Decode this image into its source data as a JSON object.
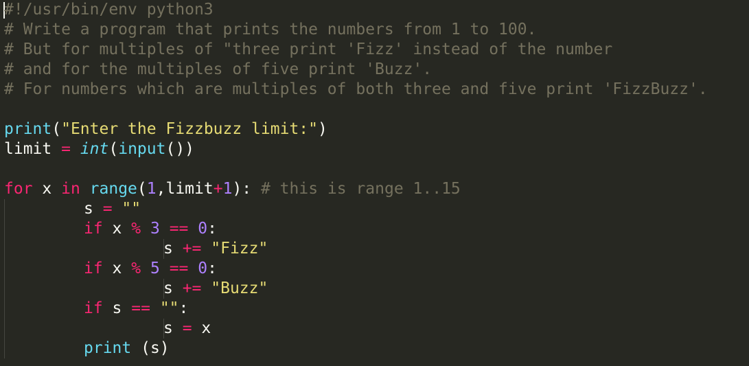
{
  "editor": {
    "theme": {
      "background": "#272822",
      "foreground": "#f8f8f2",
      "comment": "#75715e",
      "keyword": "#f92672",
      "builtin": "#66d9ef",
      "string": "#e6db74",
      "number": "#ae81ff"
    },
    "lines": [
      {
        "indent": 0,
        "tokens": [
          [
            "comment",
            "#!/usr/bin/env python3"
          ]
        ]
      },
      {
        "indent": 0,
        "tokens": [
          [
            "comment",
            "# Write a program that prints the numbers from 1 to 100."
          ]
        ]
      },
      {
        "indent": 0,
        "tokens": [
          [
            "comment",
            "# But for multiples of \"three print 'Fizz' instead of the number"
          ]
        ]
      },
      {
        "indent": 0,
        "tokens": [
          [
            "comment",
            "# and for the multiples of five print 'Buzz'."
          ]
        ]
      },
      {
        "indent": 0,
        "tokens": [
          [
            "comment",
            "# For numbers which are multiples of both three and five print 'FizzBuzz'."
          ]
        ]
      },
      {
        "indent": 0,
        "tokens": []
      },
      {
        "indent": 0,
        "tokens": [
          [
            "builtin",
            "print"
          ],
          [
            "text",
            "("
          ],
          [
            "string",
            "\"Enter the Fizzbuzz limit:\""
          ],
          [
            "text",
            ")"
          ]
        ]
      },
      {
        "indent": 0,
        "tokens": [
          [
            "text",
            "limit "
          ],
          [
            "operator",
            "="
          ],
          [
            "text",
            " "
          ],
          [
            "type",
            "int"
          ],
          [
            "text",
            "("
          ],
          [
            "builtin",
            "input"
          ],
          [
            "text",
            "())"
          ]
        ]
      },
      {
        "indent": 0,
        "tokens": []
      },
      {
        "indent": 0,
        "tokens": [
          [
            "keyword",
            "for"
          ],
          [
            "text",
            " x "
          ],
          [
            "keyword",
            "in"
          ],
          [
            "text",
            " "
          ],
          [
            "builtin",
            "range"
          ],
          [
            "text",
            "("
          ],
          [
            "number",
            "1"
          ],
          [
            "text",
            ",limit"
          ],
          [
            "operator",
            "+"
          ],
          [
            "number",
            "1"
          ],
          [
            "text",
            "): "
          ],
          [
            "comment",
            "# this is range 1..15"
          ]
        ]
      },
      {
        "indent": 1,
        "tokens": [
          [
            "text",
            "s "
          ],
          [
            "operator",
            "="
          ],
          [
            "text",
            " "
          ],
          [
            "string",
            "\"\""
          ]
        ]
      },
      {
        "indent": 1,
        "tokens": [
          [
            "keyword",
            "if"
          ],
          [
            "text",
            " x "
          ],
          [
            "operator",
            "%"
          ],
          [
            "text",
            " "
          ],
          [
            "number",
            "3"
          ],
          [
            "text",
            " "
          ],
          [
            "operator",
            "=="
          ],
          [
            "text",
            " "
          ],
          [
            "number",
            "0"
          ],
          [
            "text",
            ":"
          ]
        ]
      },
      {
        "indent": 2,
        "tokens": [
          [
            "text",
            "s "
          ],
          [
            "operator",
            "+="
          ],
          [
            "text",
            " "
          ],
          [
            "string",
            "\"Fizz\""
          ]
        ]
      },
      {
        "indent": 1,
        "tokens": [
          [
            "keyword",
            "if"
          ],
          [
            "text",
            " x "
          ],
          [
            "operator",
            "%"
          ],
          [
            "text",
            " "
          ],
          [
            "number",
            "5"
          ],
          [
            "text",
            " "
          ],
          [
            "operator",
            "=="
          ],
          [
            "text",
            " "
          ],
          [
            "number",
            "0"
          ],
          [
            "text",
            ":"
          ]
        ]
      },
      {
        "indent": 2,
        "tokens": [
          [
            "text",
            "s "
          ],
          [
            "operator",
            "+="
          ],
          [
            "text",
            " "
          ],
          [
            "string",
            "\"Buzz\""
          ]
        ]
      },
      {
        "indent": 1,
        "tokens": [
          [
            "keyword",
            "if"
          ],
          [
            "text",
            " s "
          ],
          [
            "operator",
            "=="
          ],
          [
            "text",
            " "
          ],
          [
            "string",
            "\"\""
          ],
          [
            "text",
            ":"
          ]
        ]
      },
      {
        "indent": 2,
        "tokens": [
          [
            "text",
            "s "
          ],
          [
            "operator",
            "="
          ],
          [
            "text",
            " x"
          ]
        ]
      },
      {
        "indent": 1,
        "tokens": [
          [
            "builtin",
            "print"
          ],
          [
            "text",
            " (s)"
          ]
        ]
      }
    ]
  }
}
